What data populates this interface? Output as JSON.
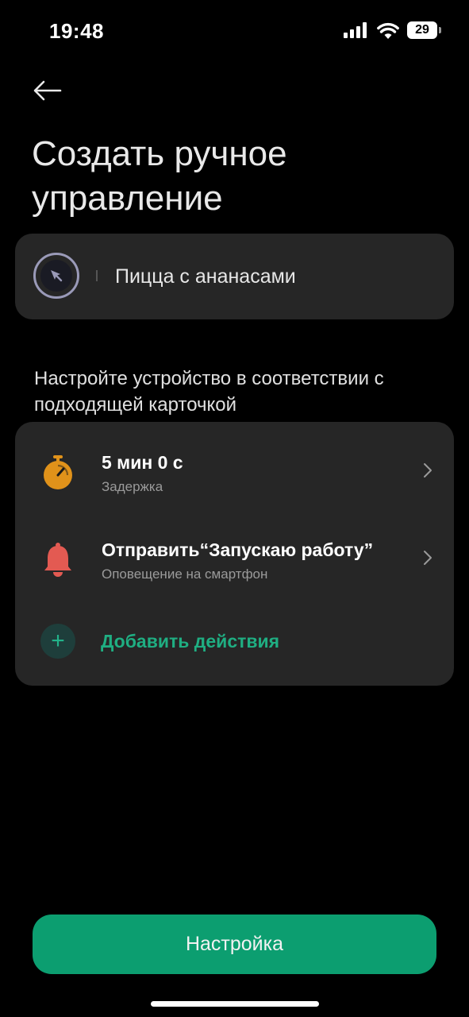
{
  "status_bar": {
    "time": "19:48",
    "battery": "29",
    "icons": [
      "signal-icon",
      "wifi-icon",
      "battery-icon"
    ]
  },
  "header": {
    "back_icon": "arrow-left-icon",
    "title": "Создать ручное управление"
  },
  "name_field": {
    "value": "Пицца с ананасами",
    "icon": "cursor-click-icon"
  },
  "section": {
    "description": "Настройте устройство в соответствии с подходящей карточкой"
  },
  "actions": [
    {
      "title": "5 мин 0 с",
      "subtitle": "Задержка",
      "icon": "stopwatch-icon",
      "color": "#e0921a"
    },
    {
      "title": "Отправить“Запускаю работу”",
      "subtitle": "Оповещение на смартфон",
      "icon": "bell-icon",
      "color": "#e35a52"
    }
  ],
  "add_action": {
    "label": "Добавить действия",
    "icon": "plus-icon"
  },
  "primary_button": {
    "label": "Настройка"
  },
  "colors": {
    "accent": "#0c9e70",
    "card": "#262626",
    "background": "#000000"
  }
}
